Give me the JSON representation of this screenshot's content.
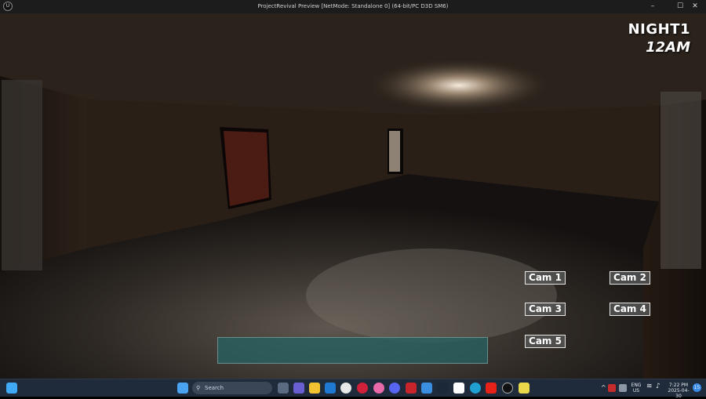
{
  "window": {
    "title": "ProjectRevival Preview [NetMode: Standalone 0]  (64-bit/PC D3D SM6)",
    "logo": "unreal-engine-logo",
    "controls": {
      "minimize": "–",
      "maximize": "☐",
      "close": "✕"
    }
  },
  "hud": {
    "night": "NIGHT1",
    "time": "12AM"
  },
  "cameras": [
    {
      "label": "Cam 1"
    },
    {
      "label": "Cam 2"
    },
    {
      "label": "Cam 3"
    },
    {
      "label": "Cam 4"
    },
    {
      "label": "Cam 5"
    }
  ],
  "taskbar": {
    "search_label": "Search",
    "language": "ENG",
    "region": "US",
    "time": "7:22 PM",
    "date": "2025-04-30",
    "notification_count": "15",
    "apps": [
      "task-view-icon",
      "teams-icon",
      "file-explorer-icon",
      "outlook-icon",
      "chrome-icon",
      "opera-icon",
      "itunes-icon",
      "discord-icon",
      "app-red-icon",
      "store-icon",
      "steam-icon",
      "notion-icon",
      "edge-icon",
      "youtube-icon",
      "unreal-editor-icon",
      "app-bolt-icon"
    ]
  }
}
